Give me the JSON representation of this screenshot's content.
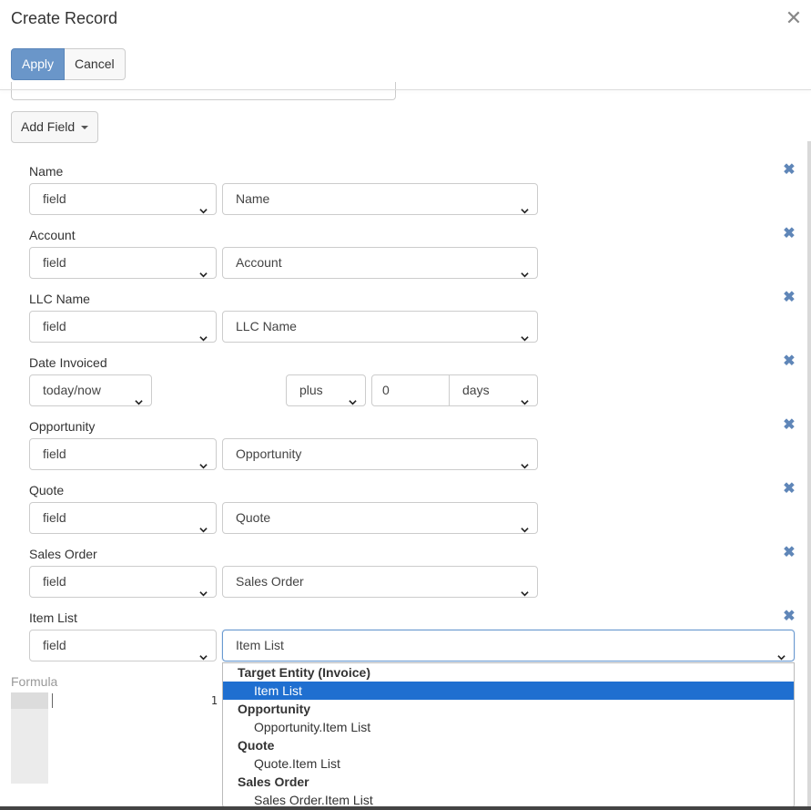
{
  "modal": {
    "title": "Create Record"
  },
  "toolbar": {
    "apply_label": "Apply",
    "cancel_label": "Cancel"
  },
  "add_field_label": "Add Field",
  "fields": [
    {
      "label": "Name",
      "type": "field",
      "value": "Name"
    },
    {
      "label": "Account",
      "type": "field",
      "value": "Account"
    },
    {
      "label": "LLC Name",
      "type": "field",
      "value": "LLC Name"
    },
    {
      "label": "Date Invoiced",
      "type": "today/now",
      "shift": "plus",
      "amount": "0",
      "unit": "days"
    },
    {
      "label": "Opportunity",
      "type": "field",
      "value": "Opportunity"
    },
    {
      "label": "Quote",
      "type": "field",
      "value": "Quote"
    },
    {
      "label": "Sales Order",
      "type": "field",
      "value": "Sales Order"
    },
    {
      "label": "Item List",
      "type": "field",
      "value": "Item List"
    }
  ],
  "formula": {
    "label": "Formula",
    "line_number": "1"
  },
  "dropdown": {
    "groups": [
      {
        "label": "Target Entity (Invoice)",
        "items": [
          "Item List"
        ]
      },
      {
        "label": "Opportunity",
        "items": [
          "Opportunity.Item List"
        ]
      },
      {
        "label": "Quote",
        "items": [
          "Quote.Item List"
        ]
      },
      {
        "label": "Sales Order",
        "items": [
          "Sales Order.Item List"
        ]
      }
    ],
    "selected": "Item List"
  },
  "colors": {
    "primary": "#6a96c9",
    "remove_icon": "#5f86b8",
    "selected_option": "#1f6fd0"
  }
}
